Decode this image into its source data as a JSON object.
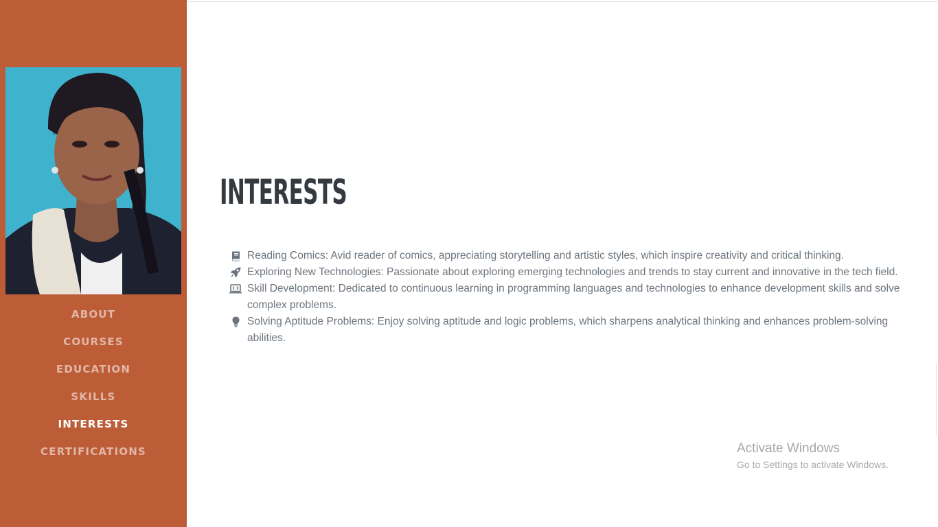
{
  "sidebar": {
    "nav": [
      {
        "label": "About",
        "active": false
      },
      {
        "label": "Courses",
        "active": false
      },
      {
        "label": "Education",
        "active": false
      },
      {
        "label": "Skills",
        "active": false
      },
      {
        "label": "Interests",
        "active": true
      },
      {
        "label": "Certifications",
        "active": false
      }
    ]
  },
  "main": {
    "section_title": "Interests",
    "interests": [
      {
        "icon": "book-icon",
        "text": "Reading Comics: Avid reader of comics, appreciating storytelling and artistic styles, which inspire creativity and critical thinking."
      },
      {
        "icon": "rocket-icon",
        "text": "Exploring New Technologies: Passionate about exploring emerging technologies and trends to stay current and innovative in the tech field."
      },
      {
        "icon": "laptop-code-icon",
        "text": "Skill Development: Dedicated to continuous learning in programming languages and technologies to enhance development skills and solve complex problems."
      },
      {
        "icon": "lightbulb-icon",
        "text": "Solving Aptitude Problems: Enjoy solving aptitude and logic problems, which sharpens analytical thinking and enhances problem-solving abilities."
      }
    ]
  },
  "watermark": {
    "title": "Activate Windows",
    "subtitle": "Go to Settings to activate Windows."
  },
  "colors": {
    "sidebar_bg": "#bd5d38",
    "heading": "#343a40",
    "body_text": "#6c757d",
    "photo_bg": "#3fb3cd"
  }
}
